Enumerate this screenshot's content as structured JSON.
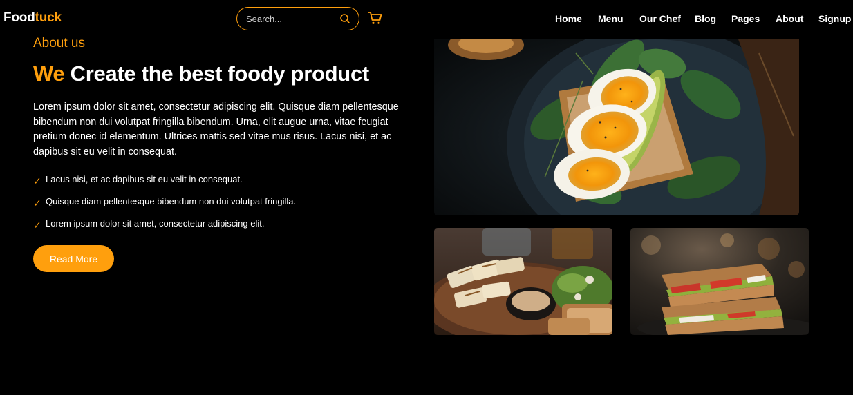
{
  "brand": {
    "part1": "Food",
    "part2": "tuck"
  },
  "search": {
    "placeholder": "Search...",
    "value": ""
  },
  "icons": {
    "search": "search-icon",
    "cart": "cart-icon",
    "check": "check-icon"
  },
  "nav": {
    "items": [
      {
        "label": "Home"
      },
      {
        "label": "Menu"
      },
      {
        "label": "Our Chef"
      },
      {
        "label": "Blog"
      },
      {
        "label": "Pages"
      },
      {
        "label": "About"
      },
      {
        "label": "Signup"
      }
    ]
  },
  "about": {
    "eyebrow": "About us",
    "headline_accent": "We",
    "headline_rest": "Create the best foody product",
    "body": "Lorem ipsum dolor sit amet, consectetur adipiscing elit. Quisque diam pellentesque bibendum non dui volutpat fringilla bibendum. Urna, elit augue urna, vitae feugiat pretium donec id elementum. Ultrices mattis sed vitae mus risus. Lacus nisi, et ac dapibus sit eu velit in consequat.",
    "checklist": [
      {
        "check": "✓",
        "text": "Lacus nisi, et ac dapibus sit eu velit in consequat."
      },
      {
        "check": "✓",
        "text": "Quisque diam pellentesque bibendum non dui volutpat fringilla."
      },
      {
        "check": "✓",
        "text": "Lorem ipsum dolor sit amet, consectetur adipiscing elit."
      }
    ],
    "button_label": "Read More"
  },
  "colors": {
    "accent": "#ff9f0d",
    "background": "#000000",
    "text": "#ffffff"
  }
}
